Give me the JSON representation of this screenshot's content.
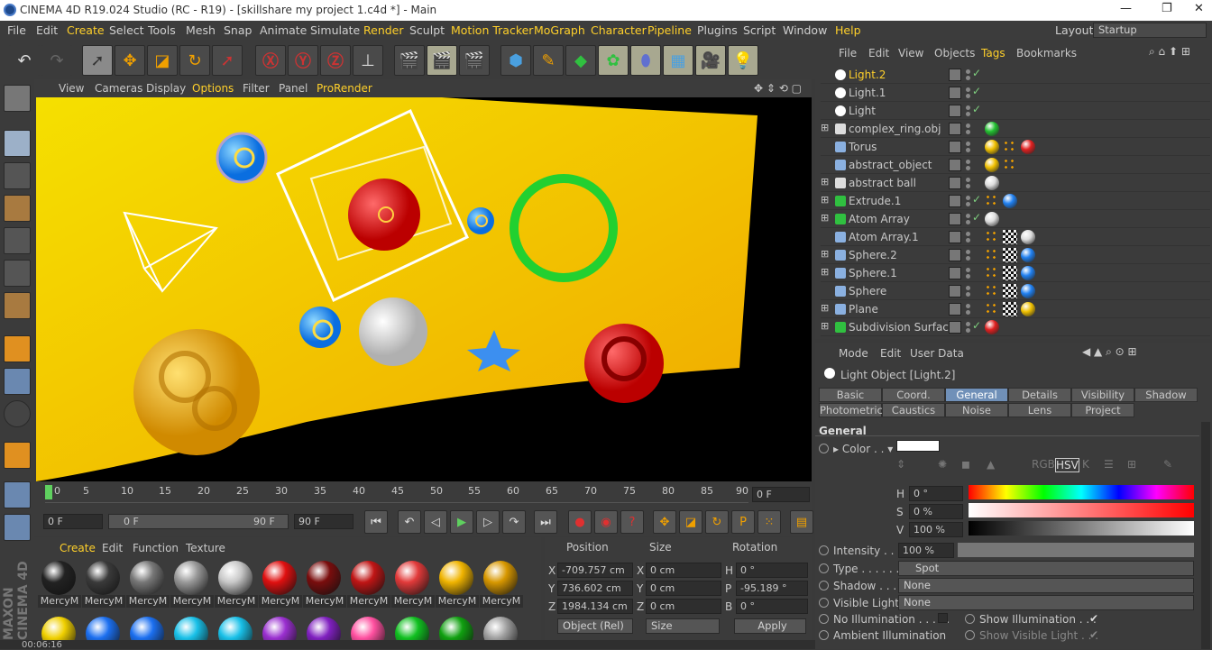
{
  "titlebar": {
    "title": "CINEMA 4D R19.024 Studio (RC - R19) - [skillshare my project 1.c4d *] - Main"
  },
  "menu": [
    "File",
    "Edit",
    "Create",
    "Select",
    "Tools",
    "Mesh",
    "Snap",
    "Animate",
    "Simulate",
    "Render",
    "Sculpt",
    "Motion Tracker",
    "MoGraph",
    "Character",
    "Pipeline",
    "Plugins",
    "Script",
    "Window",
    "Help"
  ],
  "layout": {
    "label": "Layout:",
    "value": "Startup"
  },
  "viewport_menu": [
    "View",
    "Cameras",
    "Display",
    "Options",
    "Filter",
    "Panel",
    "ProRender"
  ],
  "timeline": {
    "ticks": [
      "0",
      "5",
      "10",
      "15",
      "20",
      "25",
      "30",
      "35",
      "40",
      "45",
      "50",
      "55",
      "60",
      "65",
      "70",
      "75",
      "80",
      "85",
      "90"
    ],
    "current_frame": "0 F",
    "start": "0 F",
    "range_start": "0 F",
    "range_end": "90 F",
    "end": "90 F"
  },
  "materials": {
    "menu": [
      "Create",
      "Edit",
      "Function",
      "Texture"
    ],
    "items": [
      "MercyM",
      "MercyM",
      "MercyM",
      "MercyM",
      "MercyM",
      "MercyM",
      "MercyM",
      "MercyM",
      "MercyM",
      "MercyM",
      "MercyM"
    ],
    "colors": [
      "#222",
      "#3a3a3a",
      "#777",
      "#999",
      "#c8c8c8",
      "#e01010",
      "#7a0d0d",
      "#c01515",
      "#e23a3a",
      "#f0b400",
      "#d89800"
    ],
    "row2_colors": [
      "#f0d000",
      "#1b6ff0",
      "#1b6ff0",
      "#18c0e8",
      "#18c0e8",
      "#9a2fd0",
      "#8020c0",
      "#ff50a0",
      "#10c020",
      "#10a010",
      "#a0a0a0"
    ]
  },
  "coords": {
    "headers": [
      "Position",
      "Size",
      "Rotation"
    ],
    "x": "-709.757 cm",
    "y": "736.602 cm",
    "z": "1984.134 cm",
    "sx": "0 cm",
    "sy": "0 cm",
    "sz": "0 cm",
    "h": "0 °",
    "p": "-95.189 °",
    "b": "0 °",
    "mode": "Object (Rel)",
    "size_mode": "Size",
    "apply": "Apply",
    "axis_labels": [
      "X",
      "Y",
      "Z",
      "X",
      "Y",
      "Z",
      "H",
      "P",
      "B"
    ]
  },
  "objmgr": {
    "menu": [
      "File",
      "Edit",
      "View",
      "Objects",
      "Tags",
      "Bookmarks"
    ],
    "objects": [
      "Light.2",
      "Light.1",
      "Light",
      "complex_ring.obj",
      "Torus",
      "abstract_object",
      "abstract ball",
      "Extrude.1",
      "Atom Array",
      "Atom Array.1",
      "Sphere.2",
      "Sphere.1",
      "Sphere",
      "Plane",
      "Subdivision Surface"
    ]
  },
  "attr": {
    "menu": [
      "Mode",
      "Edit",
      "User Data"
    ],
    "title": "Light Object [Light.2]",
    "tabs_row1": [
      "Basic",
      "Coord.",
      "General",
      "Details",
      "Visibility",
      "Shadow"
    ],
    "tabs_row2": [
      "Photometric",
      "Caustics",
      "Noise",
      "Lens",
      "Project"
    ],
    "section": "General",
    "color_label": "Color . .",
    "h_label": "H",
    "h_val": "0 °",
    "s_label": "S",
    "s_val": "0 %",
    "v_label": "V",
    "v_val": "100 %",
    "intensity_label": "Intensity . . .",
    "intensity_val": "100 %",
    "type_label": "Type . . . . . .",
    "type_val": "Spot",
    "shadow_label": "Shadow . . . .",
    "shadow_val": "None",
    "vislight_label": "Visible Light",
    "vislight_val": "None",
    "noillum": "No Illumination . . . . .",
    "showillum": "Show Illumination . . .",
    "ambient": "Ambient Illumination",
    "showvis": "Show Visible Light . . .",
    "colormodes": [
      "RGB",
      "HSV",
      "K"
    ]
  },
  "status": {
    "time": "00:06:16"
  },
  "brand": "MAXON CINEMA 4D"
}
